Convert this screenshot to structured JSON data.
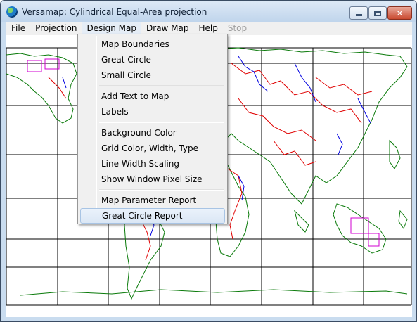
{
  "window": {
    "title": "Versamap: Cylindrical Equal-Area projection",
    "icon": "globe-icon"
  },
  "menubar": {
    "items": [
      {
        "label": "File",
        "state": "normal"
      },
      {
        "label": "Projection",
        "state": "normal"
      },
      {
        "label": "Design Map",
        "state": "open"
      },
      {
        "label": "Draw Map",
        "state": "normal"
      },
      {
        "label": "Help",
        "state": "normal"
      },
      {
        "label": "Stop",
        "state": "disabled"
      }
    ]
  },
  "design_menu": {
    "groups": [
      [
        "Map Boundaries",
        "Great Circle",
        "Small Circle"
      ],
      [
        "Add Text to Map",
        "Labels"
      ],
      [
        "Background Color",
        "Grid Color, Width, Type",
        "Line Width Scaling",
        "Show Window Pixel Size"
      ],
      [
        "Map Parameter Report",
        "Great Circle Report"
      ]
    ],
    "highlighted": "Great Circle Report"
  },
  "map": {
    "projection": "Cylindrical Equal-Area",
    "colors": {
      "grid": "#000000",
      "coastline": "#0a7a0a",
      "borders": "#e00000",
      "rivers": "#0000e0",
      "highlight": "#d000d0"
    }
  },
  "colors": {
    "titlebar": "#c9dcef",
    "menubar": "#f0f0f0",
    "close_button": "#c9492f"
  }
}
